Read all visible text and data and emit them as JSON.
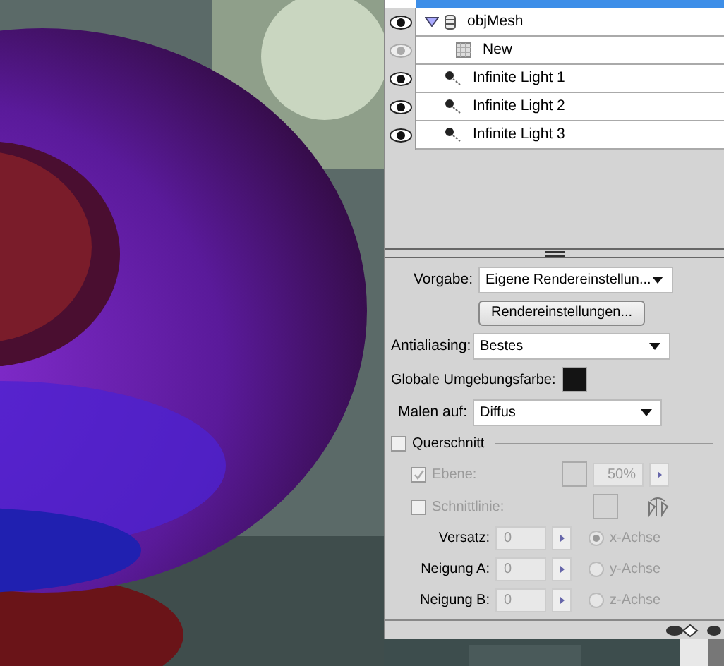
{
  "layers": [
    {
      "name": "objMesh",
      "kind": "mesh",
      "visible": true,
      "expanded": true,
      "children": [
        {
          "name": "New",
          "kind": "texture",
          "visible": false
        }
      ]
    },
    {
      "name": "Infinite Light 1",
      "kind": "light",
      "visible": true
    },
    {
      "name": "Infinite Light 2",
      "kind": "light",
      "visible": true
    },
    {
      "name": "Infinite Light 3",
      "kind": "light",
      "visible": true
    }
  ],
  "settings": {
    "preset": {
      "label": "Vorgabe:",
      "value": "Eigene Rendereinstellun..."
    },
    "render_button": "Rendereinstellungen...",
    "antialiasing": {
      "label": "Antialiasing:",
      "value": "Bestes"
    },
    "ambient": {
      "label": "Globale Umgebungsfarbe:",
      "color": "#141414"
    },
    "paint_on": {
      "label": "Malen auf:",
      "value": "Diffus"
    },
    "cross_section": {
      "label": "Querschnitt",
      "checked": false
    },
    "plane": {
      "label": "Ebene:",
      "checked": true,
      "disabled": true,
      "opacity": "50%"
    },
    "intersection": {
      "label": "Schnittlinie:",
      "checked": false,
      "disabled": true
    },
    "offsets": [
      {
        "label": "Versatz:",
        "value": "0",
        "disabled": true,
        "axis": "x-Achse",
        "selected": true
      },
      {
        "label": "Neigung A:",
        "value": "0",
        "disabled": true,
        "axis": "y-Achse",
        "selected": false
      },
      {
        "label": "Neigung B:",
        "value": "0",
        "disabled": true,
        "axis": "z-Achse",
        "selected": false
      }
    ]
  }
}
